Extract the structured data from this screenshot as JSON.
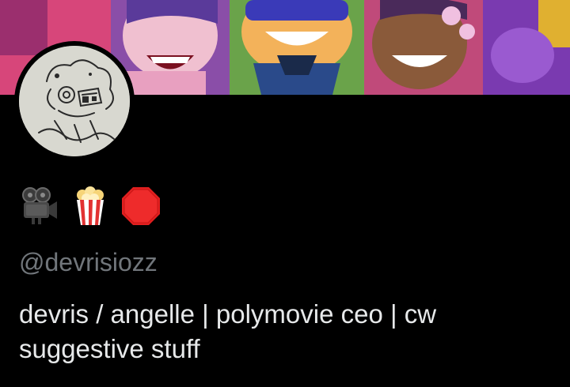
{
  "profile": {
    "banner_desc_icons": [
      "cartoon-banner-icon"
    ],
    "avatar_icon": "sketch-avatar-icon",
    "display_name_emojis": [
      "movie-camera-icon",
      "popcorn-icon",
      "stop-sign-icon"
    ],
    "handle": "@devrisiozz",
    "bio": "devris / angelle | polymovie ceo | cw suggestive stuff"
  },
  "colors": {
    "background": "#000000",
    "text_primary": "#e7e9ea",
    "text_secondary": "#71767b"
  }
}
